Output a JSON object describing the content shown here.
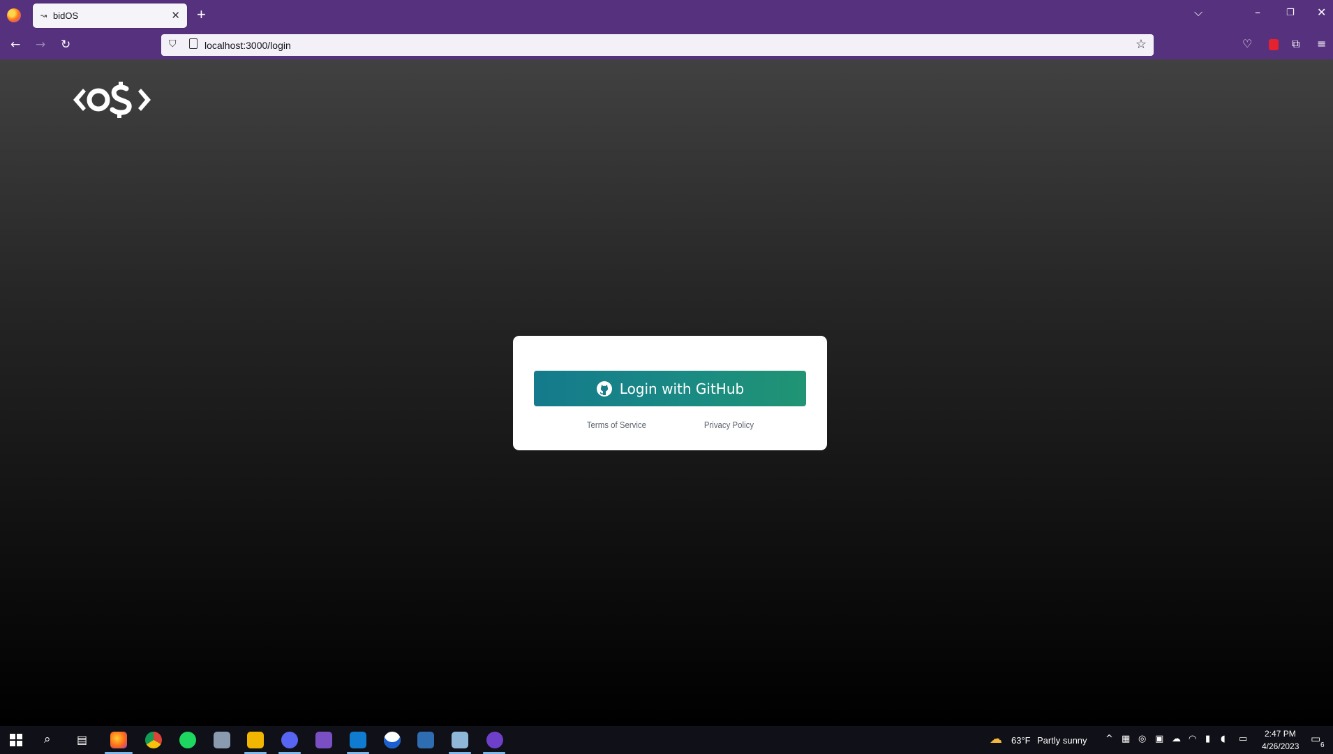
{
  "browser": {
    "tab_title": "bidOS",
    "tab_favicon": "↝",
    "url": "localhost:3000/login",
    "new_tab_label": "+",
    "close_tab_label": "✕"
  },
  "page": {
    "logo_alt": "OS logo",
    "login_button_label": "Login with GitHub",
    "terms_label": "Terms of Service",
    "privacy_label": "Privacy Policy"
  },
  "taskbar": {
    "weather_temp": "63°F",
    "weather_text": "Partly sunny",
    "time": "2:47 PM",
    "date": "4/26/2023",
    "notification_count": "6"
  },
  "colors": {
    "chrome": "#56317e",
    "button_start": "#147a8c",
    "button_end": "#209473"
  }
}
